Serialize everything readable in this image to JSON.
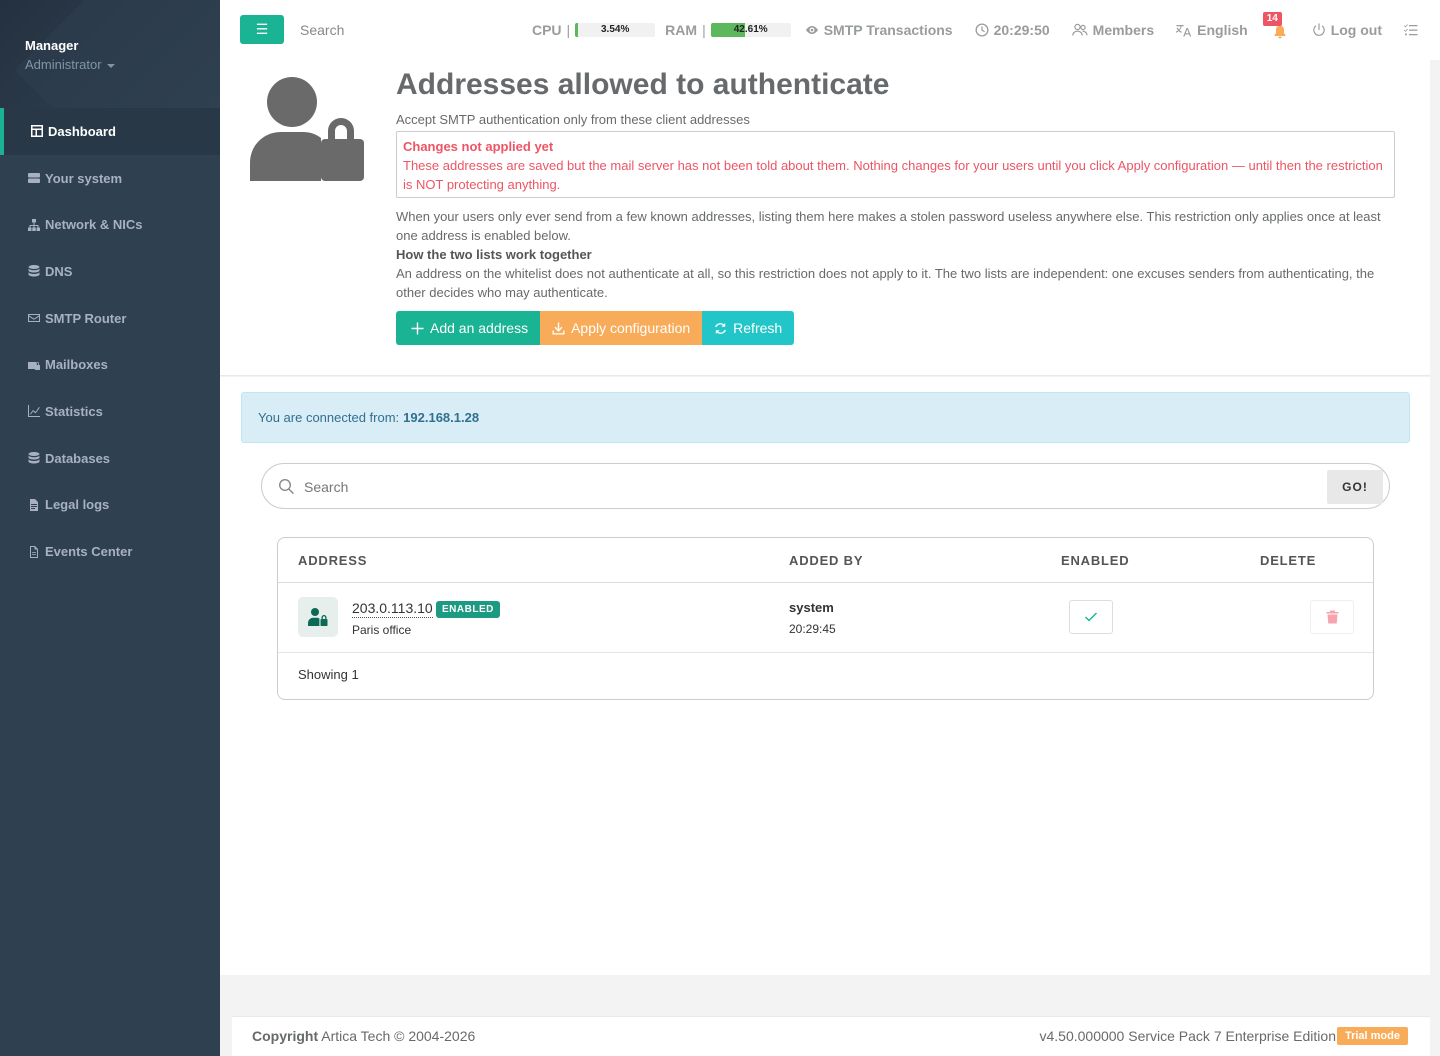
{
  "profile": {
    "name": "Manager",
    "role": "Administrator"
  },
  "sidebar": {
    "items": [
      {
        "label": "Dashboard",
        "icon": "dashboard-icon",
        "active": true
      },
      {
        "label": "Your system",
        "icon": "server-icon"
      },
      {
        "label": "Network & NICs",
        "icon": "sitemap-icon"
      },
      {
        "label": "DNS",
        "icon": "database-icon"
      },
      {
        "label": "SMTP Router",
        "icon": "envelope-icon"
      },
      {
        "label": "Mailboxes",
        "icon": "mailbox-lock-icon"
      },
      {
        "label": "Statistics",
        "icon": "chart-icon"
      },
      {
        "label": "Databases",
        "icon": "database-icon"
      },
      {
        "label": "Legal logs",
        "icon": "file-icon"
      },
      {
        "label": "Events Center",
        "icon": "file-text-icon"
      }
    ]
  },
  "topbar": {
    "search_placeholder": "Search",
    "cpu": {
      "label": "CPU",
      "separator": "|",
      "value_text": "3.54%",
      "fraction": 0.0354
    },
    "ram": {
      "label": "RAM",
      "separator": "|",
      "value_text": "42.61%",
      "fraction": 0.4261
    },
    "smtp_transactions": "SMTP Transactions",
    "clock": "20:29:50",
    "members": "Members",
    "language": "English",
    "notifications_count": "14",
    "logout": "Log out"
  },
  "header": {
    "title": "Addresses allowed to authenticate",
    "subtitle": "Accept SMTP authentication only from these client addresses",
    "warning_title": "Changes not applied yet",
    "warning_text": "These addresses are saved but the mail server has not been told about them. Nothing changes for your users until you click Apply configuration — until then the restriction is NOT protecting anything.",
    "explain_1": "When your users only ever send from a few known addresses, listing them here makes a stolen password useless anywhere else. This restriction only applies once at least one address is enabled below.",
    "explain_heading": "How the two lists work together",
    "explain_2": "An address on the whitelist does not authenticate at all, so this restriction does not apply to it. The two lists are independent: one excuses senders from authenticating, the other decides who may authenticate.",
    "buttons": {
      "add": "Add an address",
      "apply": "Apply configuration",
      "refresh": "Refresh"
    }
  },
  "connection": {
    "label": "You are connected from:",
    "ip": "192.168.1.28"
  },
  "search": {
    "placeholder": "Search",
    "go": "GO!"
  },
  "table": {
    "columns": [
      "ADDRESS",
      "ADDED BY",
      "ENABLED",
      "DELETE"
    ],
    "rows": [
      {
        "address": "203.0.113.10",
        "status": "ENABLED",
        "description": "Paris office",
        "added_by": "system",
        "added_time": "20:29:45",
        "enabled": true
      }
    ],
    "footer": "Showing 1"
  },
  "footer": {
    "copyright_label": "Copyright",
    "copyright_text": "Artica Tech © 2004-2026",
    "version": "v4.50.000000 Service Pack 7 Enterprise Edition",
    "trial": "Trial mode"
  },
  "colors": {
    "primary": "#1ab394",
    "warning": "#f8ac59",
    "info": "#23c6c8",
    "danger": "#ed5565",
    "sidebar": "#2f4050"
  }
}
